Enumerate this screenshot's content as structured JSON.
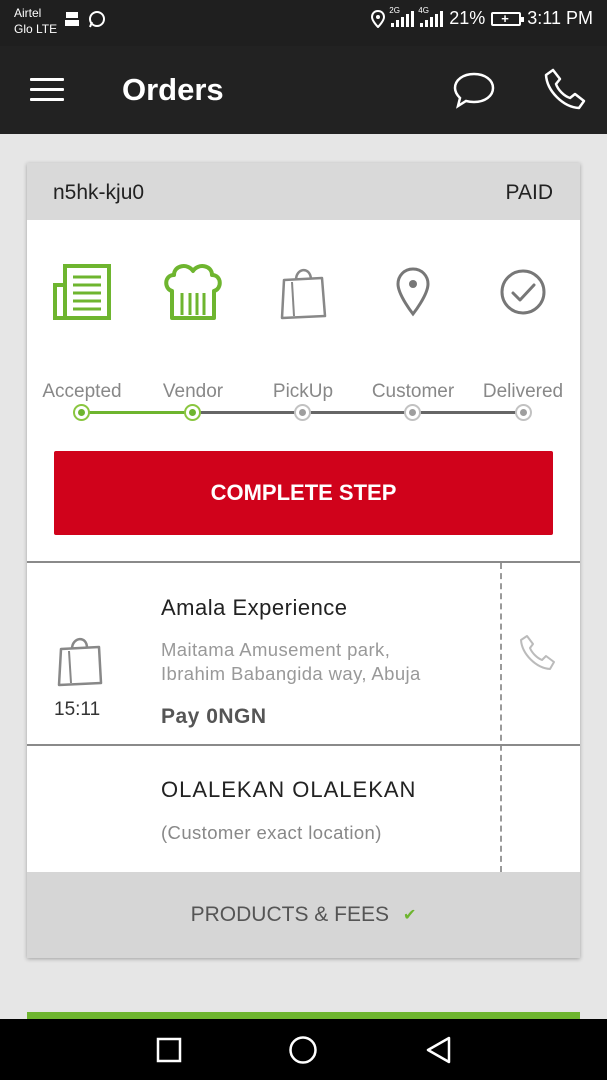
{
  "status_bar": {
    "carrier_line1": "Airtel",
    "carrier_line2": "Glo LTE",
    "network_tag_1": "2G",
    "network_tag_2": "4G",
    "battery_percent": "21%",
    "time": "3:11 PM"
  },
  "app_bar": {
    "title": "Orders",
    "icons": [
      "menu-icon",
      "chat-icon",
      "phone-icon"
    ]
  },
  "order": {
    "id": "n5hk-kju0",
    "payment_status": "PAID",
    "steps": [
      {
        "label": "Accepted",
        "icon": "receipt-icon",
        "done": true
      },
      {
        "label": "Vendor",
        "icon": "chef-hat-icon",
        "done": true
      },
      {
        "label": "PickUp",
        "icon": "shopping-bag-icon",
        "done": false
      },
      {
        "label": "Customer",
        "icon": "location-pin-icon",
        "done": false
      },
      {
        "label": "Delivered",
        "icon": "check-circle-icon",
        "done": false
      }
    ],
    "action_button": "COMPLETE STEP",
    "vendor_stop": {
      "time": "15:11",
      "name": "Amala Experience",
      "address_line1": "Maitama Amusement park,",
      "address_line2": "Ibrahim Babangida way, Abuja",
      "pay": "Pay 0NGN"
    },
    "customer_stop": {
      "name": "OLALEKAN OLALEKAN",
      "location": "(Customer exact location)"
    },
    "products_fees_label": "PRODUCTS & FEES"
  },
  "colors": {
    "accent_green": "#6eb52f",
    "action_red": "#d0021b",
    "app_bar": "#222222"
  }
}
